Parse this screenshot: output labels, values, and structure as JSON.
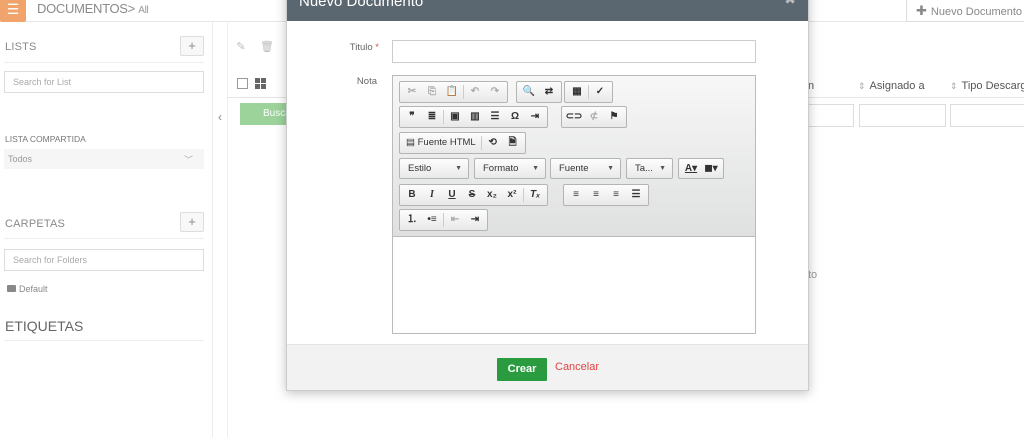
{
  "topbar": {
    "section_title": "DOCUMENTOS",
    "breadcrumb_sep": ">",
    "breadcrumb_sub": "All",
    "new_button_label": "Nuevo Documento",
    "logo_icon": "document-icon"
  },
  "sidebar": {
    "lists_title": "LISTS",
    "lists_search_placeholder": "Search for List",
    "shared_list_label": "LISTA COMPARTIDA",
    "shared_list_value": "Todos",
    "folders_title": "CARPETAS",
    "folders_search_placeholder": "Search for Folders",
    "folders": [
      {
        "label": "Default"
      }
    ],
    "tags_title": "ETIQUETAS",
    "add_symbol": "+"
  },
  "main": {
    "search_button_label": "Buscar",
    "columns": [
      {
        "label": "n"
      },
      {
        "label": "Asignado a"
      },
      {
        "label": "Tipo Descarga"
      }
    ],
    "partial_text": "to"
  },
  "modal": {
    "title": "Nuevo Documento",
    "titulo_label": "Titulo",
    "required_mark": "*",
    "titulo_value": "",
    "nota_label": "Nota",
    "toolbar": {
      "source_label": "Fuente HTML",
      "combos": [
        {
          "label": "Estilo"
        },
        {
          "label": "Formato"
        },
        {
          "label": "Fuente"
        },
        {
          "label": "Ta..."
        }
      ]
    },
    "create_label": "Crear",
    "cancel_label": "Cancelar"
  },
  "colors": {
    "accent_green": "#2a9c3f",
    "header_bg": "#5b6770",
    "cancel_red": "#e04444",
    "logo_orange": "#f0a36a"
  }
}
